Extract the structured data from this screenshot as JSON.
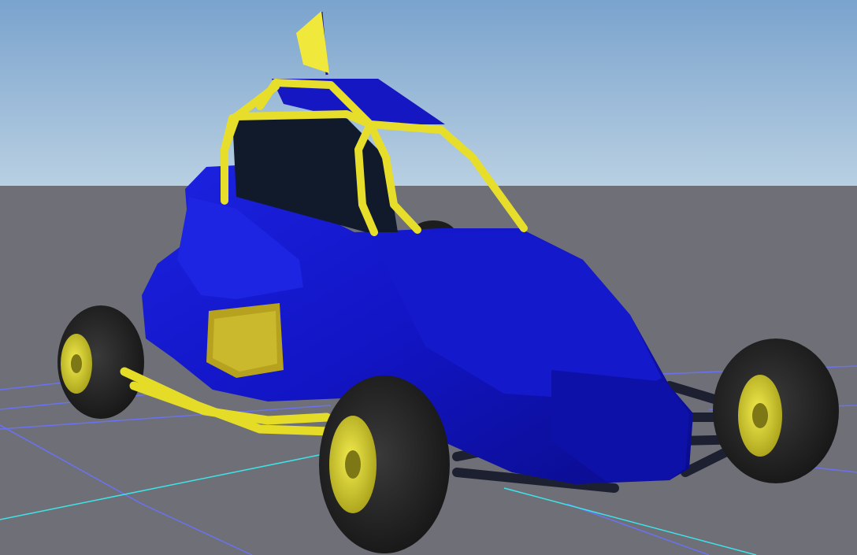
{
  "scene": {
    "description_colors": {
      "sky_top": "#7ea7cf",
      "sky_horizon": "#b7cfe1",
      "ground": "#6f6f78",
      "grid_line": "#6f78ff",
      "grid_axis": "#3fe3e6",
      "body_blue": "#1316c9",
      "body_blue_dark": "#0a0b86",
      "roll_cage_yellow": "#e8e02b",
      "tire_dark": "#252525",
      "chassis_bar": "#1c1f2b"
    },
    "objects": [
      {
        "name": "buggy-body",
        "color": "body_blue"
      },
      {
        "name": "roll-cage",
        "color": "roll_cage_yellow"
      },
      {
        "name": "flag",
        "color": "roll_cage_yellow"
      },
      {
        "name": "wheel-front-left"
      },
      {
        "name": "wheel-front-right"
      },
      {
        "name": "wheel-rear-left"
      },
      {
        "name": "chassis-frame"
      }
    ]
  }
}
